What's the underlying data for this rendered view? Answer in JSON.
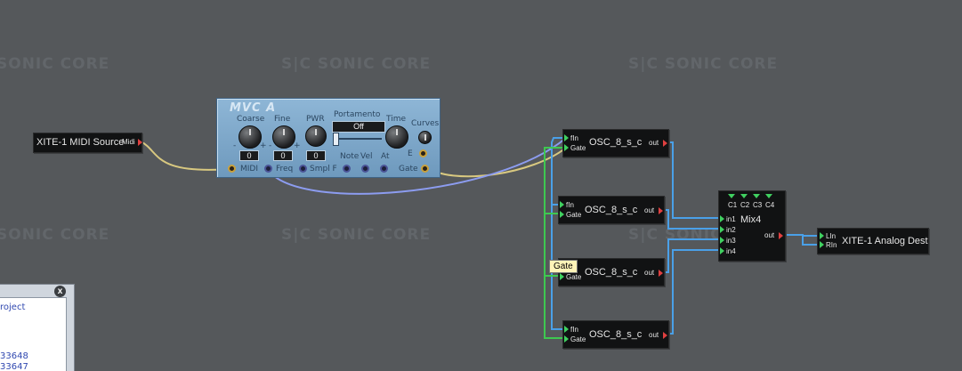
{
  "watermarks": [
    "SONIC CORE",
    "S|C  SONIC CORE",
    "S|C  SONIC CORE",
    "SONIC CORE",
    "S|C  SONIC CORE",
    "S|C  SONIC CORE"
  ],
  "midi_source": {
    "name": "XITE-1 MIDI Source",
    "pin": "Midi"
  },
  "mvc": {
    "title": "MVC A",
    "coarse_label": "Coarse",
    "fine_label": "Fine",
    "pwr_label": "PWR",
    "portamento_label": "Portamento",
    "portamento_value": "Off",
    "time_label": "Time",
    "curves_label": "Curves",
    "coarse_value": "0",
    "fine_value": "0",
    "pwr_value": "0",
    "minus": "-",
    "plus": "+",
    "row2_labels": {
      "note": "Note",
      "vel": "Vel",
      "at": "At",
      "e": "E"
    },
    "jacks": {
      "midi": "MIDI",
      "freq": "Freq",
      "smpl": "Smpl F",
      "gate": "Gate"
    }
  },
  "oscillators": [
    {
      "name": "OSC_8_s_c",
      "in1": "fIn",
      "in2": "Gate",
      "out": "out"
    },
    {
      "name": "OSC_8_s_c",
      "in1": "fIn",
      "in2": "Gate",
      "out": "out"
    },
    {
      "name": "OSC_8_s_c",
      "in1": "fIn",
      "in2": "Gate",
      "out": "out"
    },
    {
      "name": "OSC_8_s_c",
      "in1": "fIn",
      "in2": "Gate",
      "out": "out"
    }
  ],
  "mixer": {
    "name": "Mix4",
    "channels": [
      "C1",
      "C2",
      "C3",
      "C4"
    ],
    "inputs": [
      "in1",
      "in2",
      "in3",
      "in4"
    ],
    "out": "out"
  },
  "analog_dest": {
    "name": "XITE-1 Analog Dest",
    "in1": "LIn",
    "in2": "RIn"
  },
  "tooltip": "Gate",
  "properties_panel": {
    "close": "x",
    "line1": "roject",
    "line2": "33648",
    "line3": "33647"
  },
  "colors": {
    "background": "#55585b",
    "wire_blue": "#4aa0e8",
    "wire_green": "#3ec850",
    "wire_yellow": "#d8c880",
    "wire_lavender": "#8c9cf0",
    "module_panel": "#7fa7c9"
  }
}
